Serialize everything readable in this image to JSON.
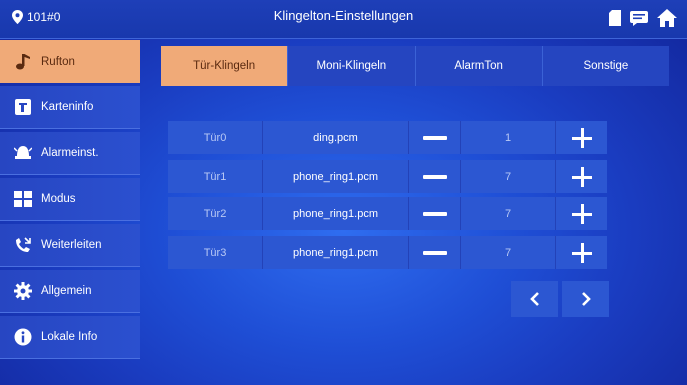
{
  "header": {
    "room": "101#0",
    "title": "Klingelton-Einstellungen"
  },
  "sidebar": {
    "items": [
      {
        "label": "Rufton",
        "icon": "music-note-icon",
        "active": true
      },
      {
        "label": "Karteninfo",
        "icon": "card-icon",
        "active": false
      },
      {
        "label": "Alarmeinst.",
        "icon": "alarm-icon",
        "active": false
      },
      {
        "label": "Modus",
        "icon": "grid-icon",
        "active": false
      },
      {
        "label": "Weiterleiten",
        "icon": "forward-call-icon",
        "active": false
      },
      {
        "label": "Allgemein",
        "icon": "gear-icon",
        "active": false
      },
      {
        "label": "Lokale Info",
        "icon": "info-icon",
        "active": false
      }
    ]
  },
  "tabs": [
    {
      "label": "Tür-Klingeln",
      "active": true
    },
    {
      "label": "Moni-Klingeln",
      "active": false
    },
    {
      "label": "AlarmTon",
      "active": false
    },
    {
      "label": "Sonstige",
      "active": false
    }
  ],
  "rows": [
    {
      "door": "Tür0",
      "file": "ding.pcm",
      "value": "1"
    },
    {
      "door": "Tür1",
      "file": "phone_ring1.pcm",
      "value": "7"
    },
    {
      "door": "Tür2",
      "file": "phone_ring1.pcm",
      "value": "7"
    },
    {
      "door": "Tür3",
      "file": "phone_ring1.pcm",
      "value": "7"
    }
  ],
  "colors": {
    "active": "#f0aa78",
    "background": "#1f4fd6",
    "cell": "#2c57d2"
  },
  "icons": {
    "home": "home-icon",
    "messages": "message-icon",
    "sdcard": "sdcard-icon",
    "prev": "chevron-left-icon",
    "next": "chevron-right-icon"
  }
}
